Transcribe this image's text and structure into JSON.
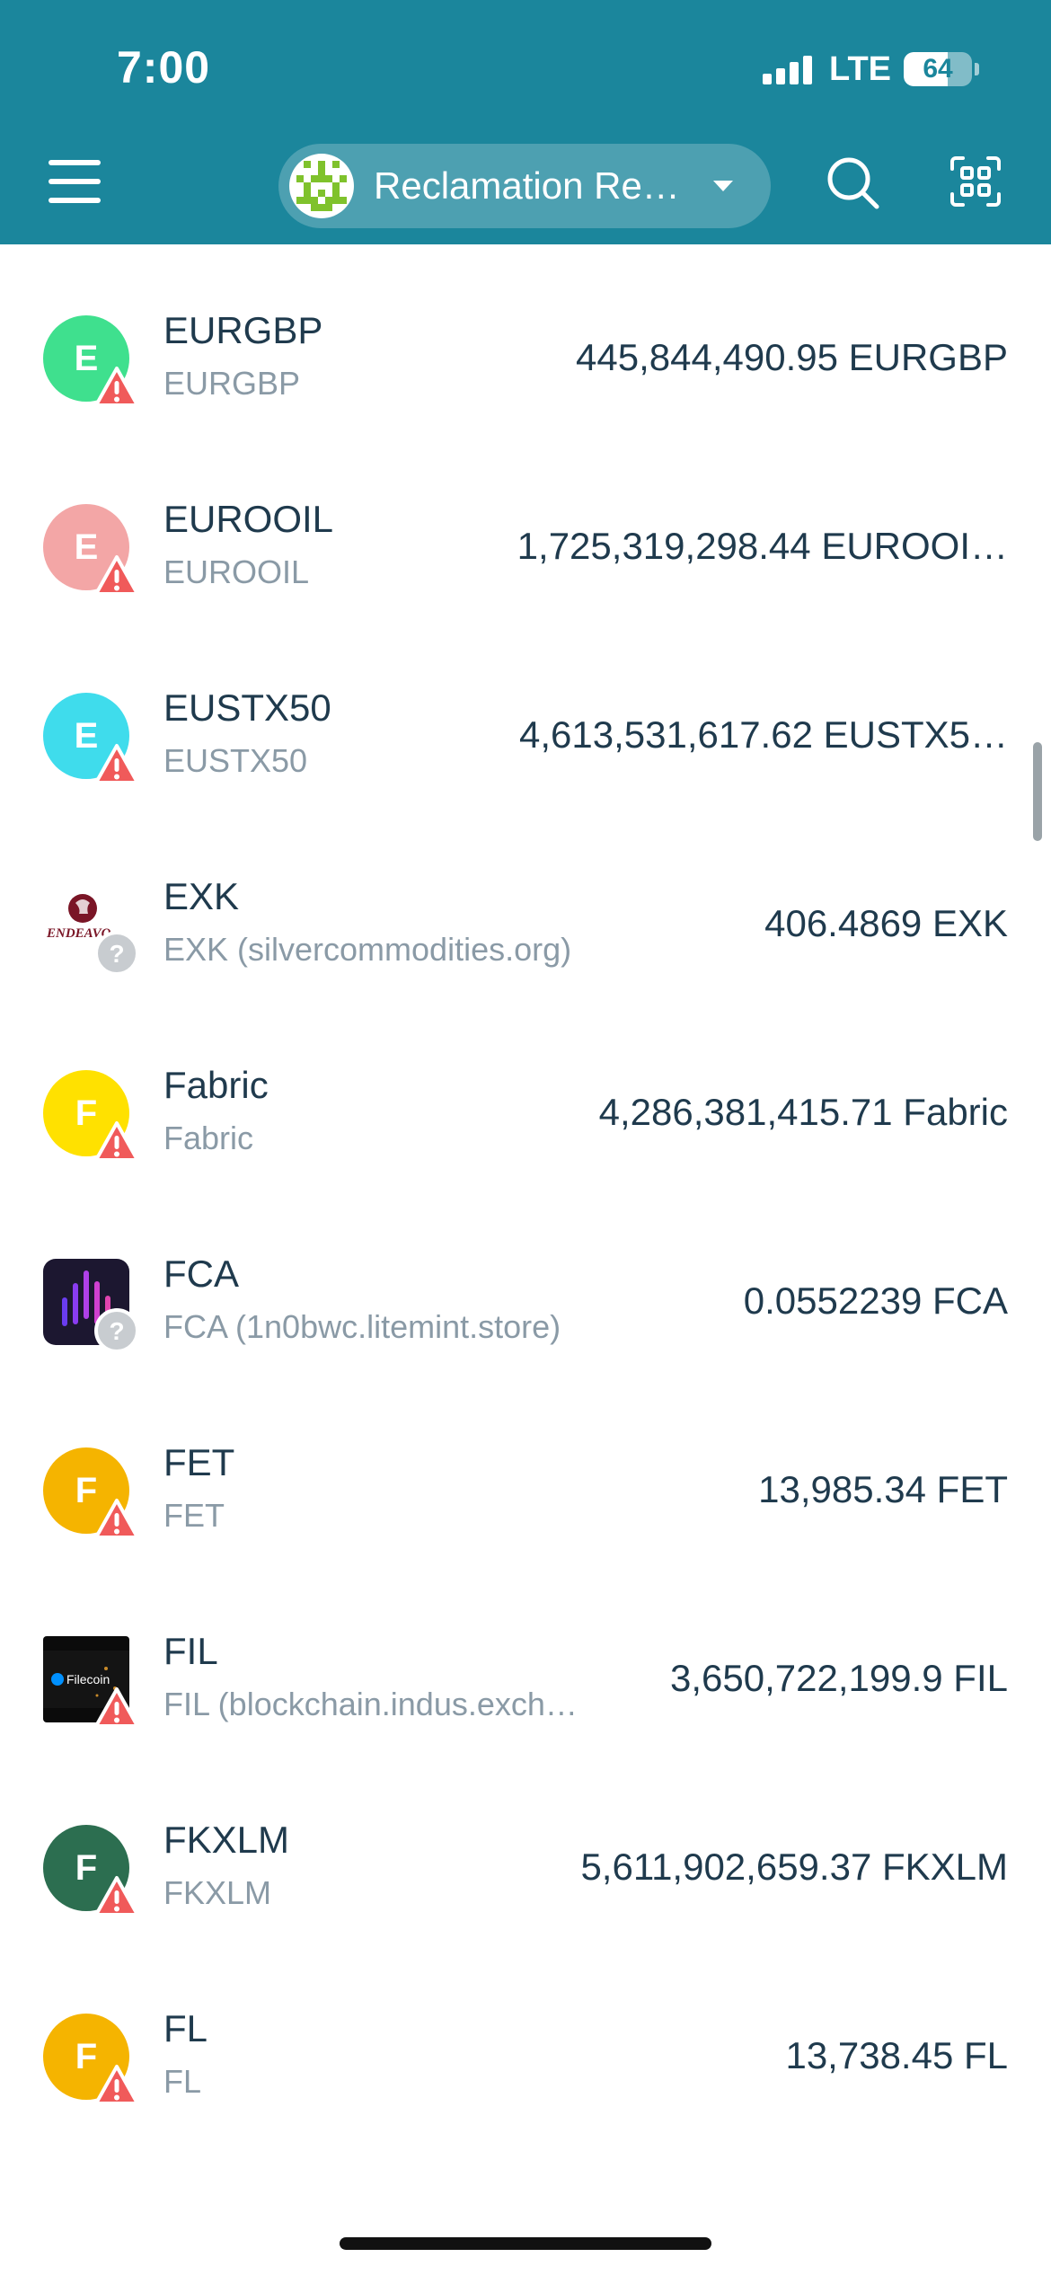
{
  "status_bar": {
    "time": "7:00",
    "network": "LTE",
    "battery": "64",
    "battery_level": 0.64
  },
  "header": {
    "wallet_name": "Reclamation Re…",
    "background_color": "#1b869c"
  },
  "assets": [
    {
      "symbol": "EURGBP",
      "subtitle": "EURGBP",
      "amount": "445,844,490.95 EURGBP",
      "icon_letter": "E",
      "icon_color": "#3fe08e",
      "icon_type": "letter",
      "badge": "warning"
    },
    {
      "symbol": "EUROOIL",
      "subtitle": "EUROOIL",
      "amount": "1,725,319,298.44 EUROOI…",
      "icon_letter": "E",
      "icon_color": "#f3a6a6",
      "icon_type": "letter",
      "badge": "warning"
    },
    {
      "symbol": "EUSTX50",
      "subtitle": "EUSTX50",
      "amount": "4,613,531,617.62 EUSTX5…",
      "icon_letter": "E",
      "icon_color": "#3fdcec",
      "icon_type": "letter",
      "badge": "warning"
    },
    {
      "symbol": "EXK",
      "subtitle": "EXK (silvercommodities.org)",
      "amount": "406.4869 EXK",
      "icon_type": "image-endeavour",
      "badge": "unknown"
    },
    {
      "symbol": "Fabric",
      "subtitle": "Fabric",
      "amount": "4,286,381,415.71 Fabric",
      "icon_letter": "F",
      "icon_color": "#ffe100",
      "icon_type": "letter",
      "badge": "warning"
    },
    {
      "symbol": "FCA",
      "subtitle": "FCA (1n0bwc.litemint.store)",
      "amount": "0.0552239 FCA",
      "icon_type": "image-fca",
      "badge": "unknown"
    },
    {
      "symbol": "FET",
      "subtitle": "FET",
      "amount": "13,985.34 FET",
      "icon_letter": "F",
      "icon_color": "#f5b400",
      "icon_type": "letter",
      "badge": "warning"
    },
    {
      "symbol": "FIL",
      "subtitle": "FIL (blockchain.indus.exch…",
      "amount": "3,650,722,199.9 FIL",
      "icon_type": "image-filecoin",
      "badge": "warning"
    },
    {
      "symbol": "FKXLM",
      "subtitle": "FKXLM",
      "amount": "5,611,902,659.37 FKXLM",
      "icon_letter": "F",
      "icon_color": "#2c6e50",
      "icon_type": "letter",
      "badge": "warning"
    },
    {
      "symbol": "FL",
      "subtitle": "FL",
      "amount": "13,738.45 FL",
      "icon_letter": "F",
      "icon_color": "#f5b400",
      "icon_type": "letter",
      "badge": "warning"
    }
  ]
}
